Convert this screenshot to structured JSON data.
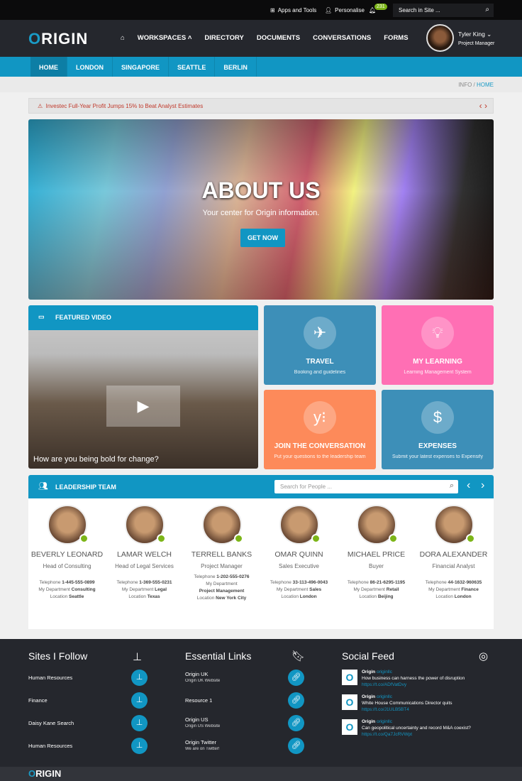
{
  "topbar": {
    "apps": "Apps and Tools",
    "personalise": "Personalise",
    "notifications": "231",
    "search_placeholder": "Search in Site ..."
  },
  "header": {
    "logo_first": "O",
    "logo_rest": "RIGIN",
    "nav": [
      "WORKSPACES",
      "DIRECTORY",
      "DOCUMENTS",
      "CONVERSATIONS",
      "FORMS"
    ],
    "user_name": "Tyler King",
    "user_role": "Project Manager"
  },
  "subnav": [
    "HOME",
    "LONDON",
    "SINGAPORE",
    "SEATTLE",
    "BERLIN"
  ],
  "breadcrumb": {
    "parent": "INFO",
    "sep": "/",
    "current": "HOME"
  },
  "alert": "Investec Full-Year Profit Jumps 15% to Beat Analyst Estimates",
  "hero": {
    "title": "ABOUT US",
    "subtitle": "Your center for Origin information.",
    "button": "GET NOW"
  },
  "video": {
    "title": "FEATURED VIDEO",
    "caption": "How are you being bold for change?"
  },
  "tiles": [
    {
      "title": "TRAVEL",
      "sub": "Booking and guidelines",
      "color": "#3d8fb8",
      "icon": "airplane-icon"
    },
    {
      "title": "MY LEARNING",
      "sub": "Learning Management System",
      "color": "#ff6fb4",
      "icon": "lightbulb-icon"
    },
    {
      "title": "JOIN THE CONVERSATION",
      "sub": "Put your questions to the leadership team",
      "color": "#fd8a5a",
      "icon": "yammer-icon"
    },
    {
      "title": "EXPENSES",
      "sub": "Submit your latest expenses to Expensify",
      "color": "#3d8fb8",
      "icon": "dollar-icon"
    }
  ],
  "leadership": {
    "title": "LEADERSHIP TEAM",
    "search_placeholder": "Search for People ...",
    "tel_label": "Telephone",
    "dept_label": "My Department",
    "loc_label": "Location",
    "people": [
      {
        "name": "BEVERLY LEONARD",
        "role": "Head of Consulting",
        "tel": "1-445-555-0899",
        "dept": "Consulting",
        "loc": "Seattle"
      },
      {
        "name": "LAMAR WELCH",
        "role": "Head of Legal Services",
        "tel": "1-369-555-0231",
        "dept": "Legal",
        "loc": "Texas"
      },
      {
        "name": "TERRELL BANKS",
        "role": "Project Manager",
        "tel": "1-202-555-0276",
        "dept": "Project Management",
        "loc": "New York City"
      },
      {
        "name": "OMAR QUINN",
        "role": "Sales Executive",
        "tel": "33-113-496-0043",
        "dept": "Sales",
        "loc": "London"
      },
      {
        "name": "MICHAEL PRICE",
        "role": "Buyer",
        "tel": "86-21-6295-1195",
        "dept": "Retail",
        "loc": "Beijing"
      },
      {
        "name": "DORA ALEXANDER",
        "role": "Financial Analyst",
        "tel": "44-1632-960635",
        "dept": "Finance",
        "loc": "London"
      }
    ]
  },
  "footer": {
    "sites_title": "Sites I Follow",
    "sites": [
      "Human Resources",
      "Finance",
      "Daisy Kane Search",
      "Human Resources"
    ],
    "links_title": "Essential Links",
    "links": [
      {
        "t": "Origin UK",
        "s": "Origin UK Website"
      },
      {
        "t": "Resource 1",
        "s": ""
      },
      {
        "t": "Origin US",
        "s": "Origin US Website"
      },
      {
        "t": "Origin Twitter",
        "s": "We are on Twitter!"
      }
    ],
    "social_title": "Social Feed",
    "feed": [
      {
        "user": "Origin",
        "handle": "originllc",
        "text": "How business can harness the power of disruption",
        "link": "https://t.co/ADfVatDvy"
      },
      {
        "user": "Origin",
        "handle": "originllc",
        "text": "White House Communications Director quits",
        "link": "https://t.co/J1ULB5BT4"
      },
      {
        "user": "Origin",
        "handle": "originllc",
        "text": "Can geopolitical uncertainty and record M&A coexist?",
        "link": "https://t.co/Qa7JcRVWpt"
      }
    ],
    "logo_first": "O",
    "logo_rest": "RIGIN"
  }
}
